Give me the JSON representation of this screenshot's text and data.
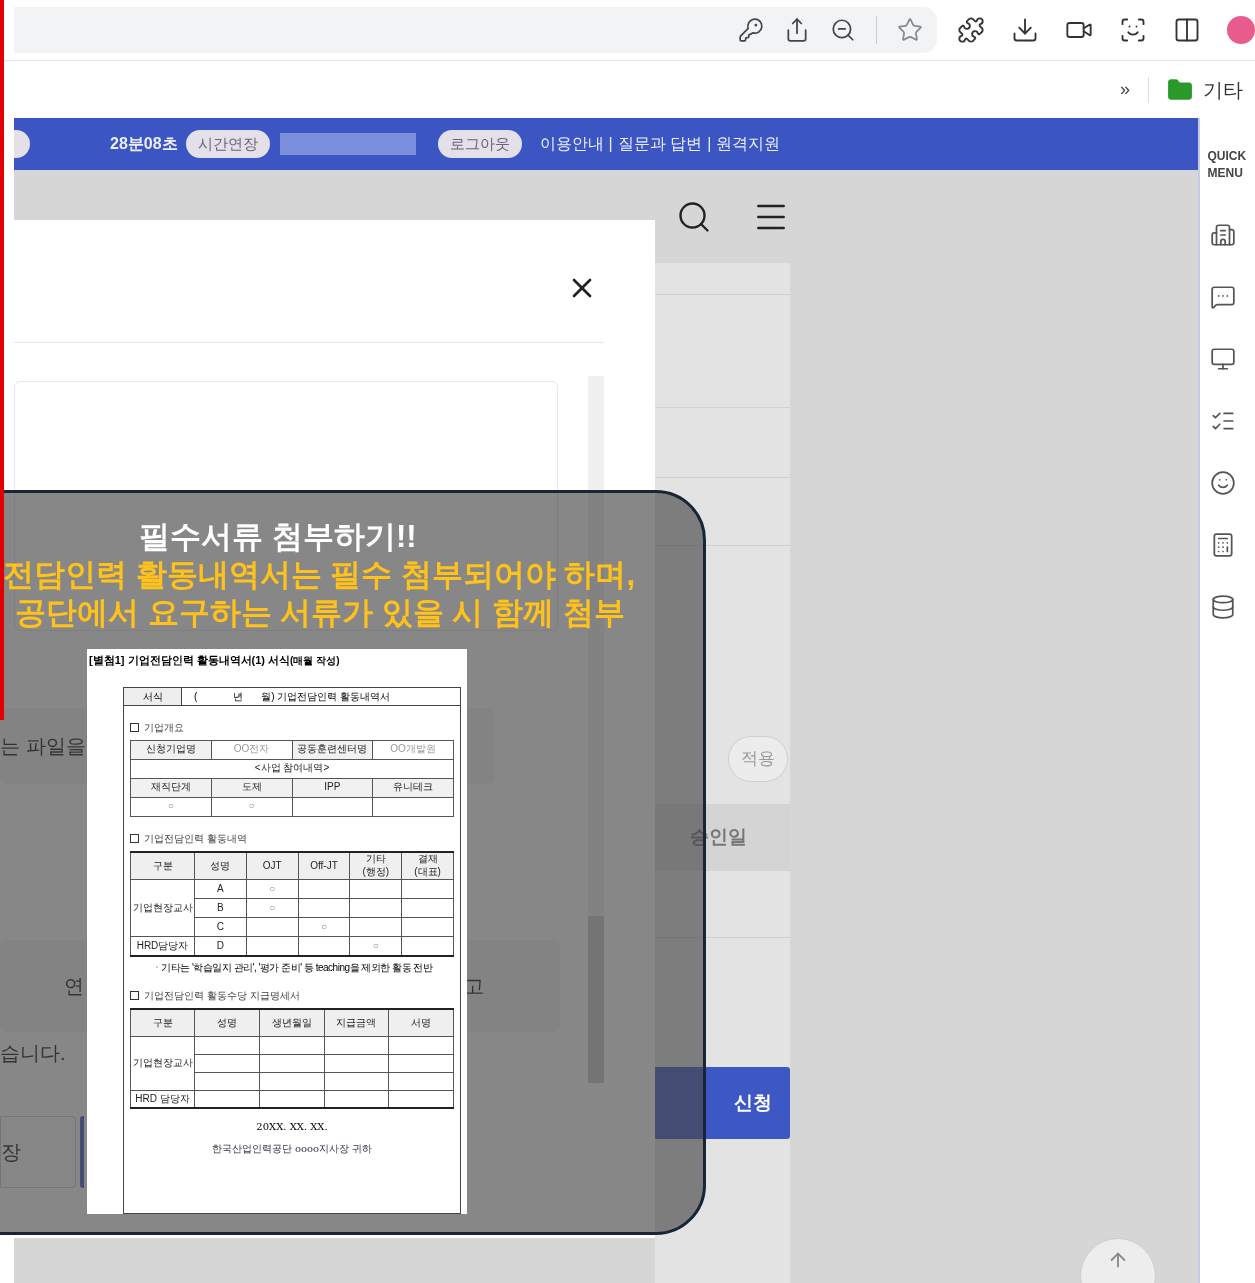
{
  "bookmarks_bar": {
    "overflow": "»",
    "folder": "기타"
  },
  "header": {
    "timer": "28분08초",
    "extend_button": "시간연장",
    "logout_button": "로그아웃",
    "links": [
      "이용안내",
      "질문과 답변",
      "원격지원"
    ],
    "separator": "|"
  },
  "background_page": {
    "file_hint_fragment": "는 파일을",
    "row_fragment_left": "연",
    "row_fragment_right": "고",
    "notice_fragment": "습니다.",
    "button_fragment": "장",
    "apply_button": "적용",
    "column_header": "승인일",
    "submit_button": "신청"
  },
  "quick_menu": {
    "title": "QUICK MENU"
  },
  "callout": {
    "title": "필수서류 첨부하기!!",
    "lines": [
      "전담인력 활동내역서는 필수 첨부되어야 하며,",
      "공단에서 요구하는 서류가 있을 시 함께 첨부"
    ]
  },
  "document": {
    "heading": "[별첨1] 기업전담인력 활동내역서(1) 서식",
    "heading_note": "(매월 작성)",
    "form_label": "서식",
    "form_title": [
      "(",
      "년",
      "월) 기업전담인력 활동내역서"
    ],
    "overview": {
      "title": "기업개요",
      "company_row": [
        "신청기업명",
        "OO전자",
        "공동훈련센터명",
        "OO개발원"
      ],
      "participation": "<사업 참여내역>",
      "programs": [
        "재직단계",
        "도제",
        "IPP",
        "유니테크"
      ],
      "program_marks": [
        true,
        true,
        false,
        false
      ]
    },
    "activity": {
      "title": "기업전담인력 활동내역",
      "columns": [
        [
          "구분"
        ],
        [
          "성명"
        ],
        [
          "OJT"
        ],
        [
          "Off-JT"
        ],
        [
          "기타",
          "(행정)"
        ],
        [
          "결재",
          "(대표)"
        ]
      ],
      "groups": [
        {
          "category": "기업현장교사",
          "rows": [
            {
              "name": "A",
              "marks": [
                true,
                false,
                false,
                false
              ]
            },
            {
              "name": "B",
              "marks": [
                true,
                false,
                false,
                false
              ]
            },
            {
              "name": "C",
              "marks": [
                false,
                true,
                false,
                false
              ]
            }
          ]
        },
        {
          "category": "HRD담당자",
          "rows": [
            {
              "name": "D",
              "marks": [
                false,
                false,
                true,
                false
              ]
            }
          ]
        }
      ],
      "note": "ㆍ기타는 '학습일지 관리', '평가 준비' 등 teaching을 제외한 활동 전반"
    },
    "payment": {
      "title": "기업전담인력 활동수당 지급명세서",
      "columns": [
        "구분",
        "성명",
        "생년월일",
        "지급금액",
        "서명"
      ],
      "groups": [
        {
          "category": "기업현장교사"
        },
        {
          "category": "HRD 담당자"
        }
      ]
    },
    "mark_symbol": "○",
    "date": "20XX. XX. XX.",
    "addressee": "한국산업인력공단 oooo지사장 귀하"
  }
}
